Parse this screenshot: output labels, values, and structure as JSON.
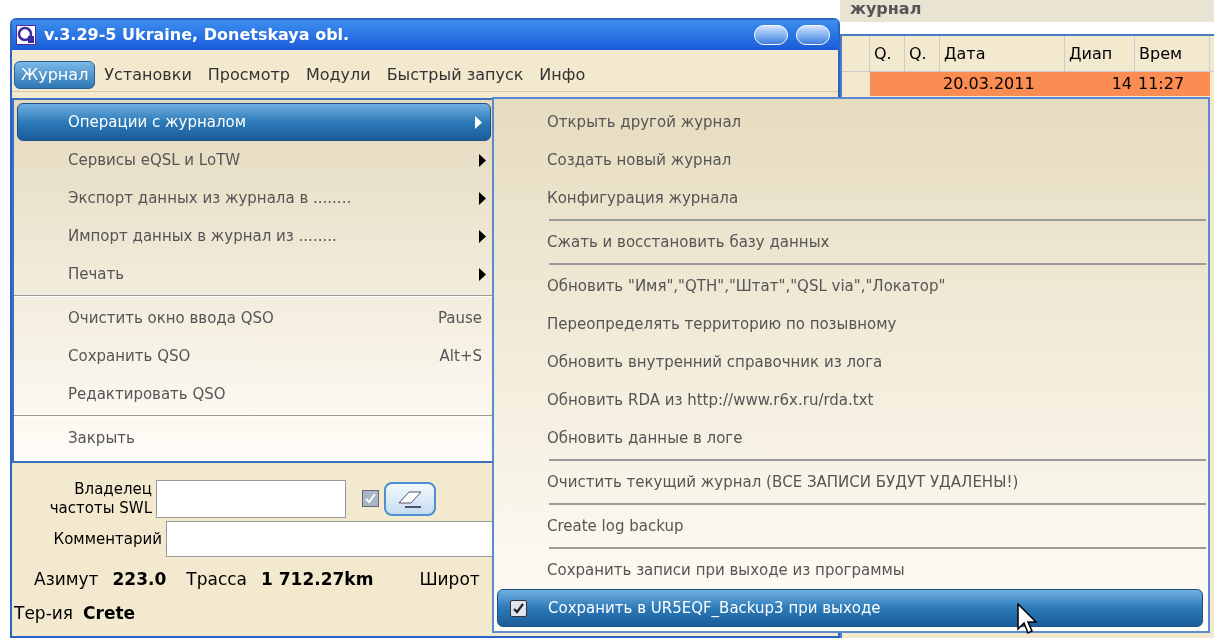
{
  "window": {
    "title": "v.3.29-5 Ukraine, Donetskaya obl."
  },
  "menu_bar": [
    {
      "label": "Журнал",
      "selected": true
    },
    {
      "label": "Установки",
      "selected": false
    },
    {
      "label": "Просмотр",
      "selected": false
    },
    {
      "label": "Модули",
      "selected": false
    },
    {
      "label": "Быстрый запуск",
      "selected": false
    },
    {
      "label": "Инфо",
      "selected": false
    }
  ],
  "log_panel": {
    "title": "журнал",
    "columns": [
      "Q.",
      "Q.",
      "Дата",
      "Диап",
      "Врем"
    ],
    "rows": [
      {
        "cells": [
          "",
          "",
          "20.03.2011",
          "14",
          "11:27"
        ],
        "color": "#fb8c52"
      }
    ]
  },
  "form": {
    "owner_label": "Владелец частоты SWL",
    "owner_checkbox": {
      "checked": true
    },
    "comment_label": "Комментарий",
    "info": [
      {
        "label": "Азимут",
        "value": "223.0"
      },
      {
        "label": "Трасса",
        "value": "1 712.27km"
      },
      {
        "label": "Широт"
      }
    ],
    "territory": {
      "label": "Тер-ия",
      "value": "Crete"
    }
  },
  "dropdown": [
    {
      "kind": "submenu",
      "label": "Операции с журналом",
      "selected": true
    },
    {
      "kind": "submenu",
      "label": "Сервисы eQSL и LoTW",
      "selected": false
    },
    {
      "kind": "submenu",
      "label": "Экспорт данных из журнала в ........",
      "selected": false
    },
    {
      "kind": "submenu",
      "label": "Импорт данных в журнал из ........",
      "selected": false
    },
    {
      "kind": "submenu",
      "label": "Печать",
      "selected": false
    },
    {
      "kind": "separator"
    },
    {
      "kind": "item",
      "label": "Очистить окно ввода QSO",
      "shortcut": "Pause",
      "selected": false
    },
    {
      "kind": "item",
      "label": "Сохранить QSO",
      "shortcut": "Alt+S",
      "selected": false
    },
    {
      "kind": "item",
      "label": "Редактировать QSO",
      "selected": false
    },
    {
      "kind": "separator"
    },
    {
      "kind": "item",
      "label": "Закрыть",
      "selected": false
    }
  ],
  "submenu": [
    {
      "kind": "item",
      "label": "Открыть другой журнал",
      "selected": false
    },
    {
      "kind": "item",
      "label": "Создать новый журнал",
      "selected": false
    },
    {
      "kind": "item",
      "label": "Конфигурация журнала",
      "selected": false
    },
    {
      "kind": "separator"
    },
    {
      "kind": "item",
      "label": "Сжать и восстановить базу данных",
      "selected": false
    },
    {
      "kind": "separator"
    },
    {
      "kind": "item",
      "label": "Обновить \"Имя\",\"QTH\",\"Штат\",\"QSL via\",\"Локатор\"",
      "selected": false
    },
    {
      "kind": "item",
      "label": "Переопределять территорию по позывному",
      "selected": false
    },
    {
      "kind": "item",
      "label": "Обновить внутренний справочник из лога",
      "selected": false
    },
    {
      "kind": "item",
      "label": "Обновить RDA из http://www.r6x.ru/rda.txt",
      "selected": false
    },
    {
      "kind": "item",
      "label": "Обновить данные в логе",
      "selected": false
    },
    {
      "kind": "separator"
    },
    {
      "kind": "item",
      "label": "Очистить текущий журнал (ВСЕ ЗАПИСИ БУДУТ УДАЛЕНЫ!)",
      "selected": false
    },
    {
      "kind": "separator"
    },
    {
      "kind": "item",
      "label": "Create log backup",
      "selected": false
    },
    {
      "kind": "separator"
    },
    {
      "kind": "item",
      "label": "Сохранить записи при выходе из программы",
      "selected": false
    },
    {
      "kind": "check",
      "label": "Сохранить в UR5EQF_Backup3 при выходе",
      "checked": true,
      "selected": true
    }
  ]
}
